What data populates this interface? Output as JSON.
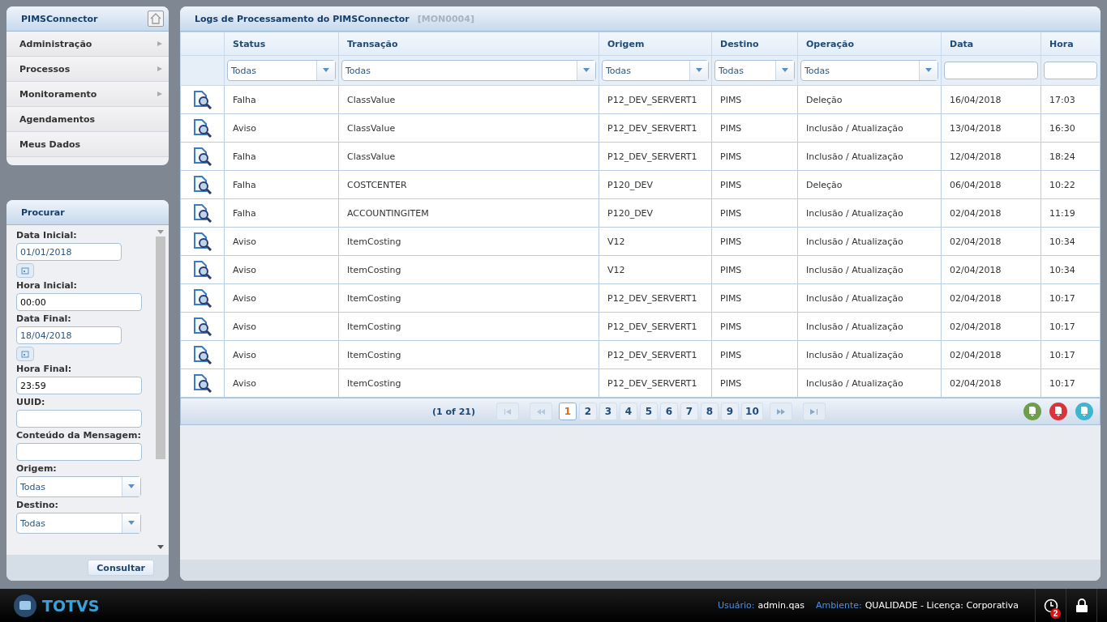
{
  "menu": {
    "title": "PIMSConnector",
    "items": [
      {
        "label": "Administração",
        "has_submenu": true
      },
      {
        "label": "Processos",
        "has_submenu": true
      },
      {
        "label": "Monitoramento",
        "has_submenu": true
      },
      {
        "label": "Agendamentos",
        "has_submenu": false
      },
      {
        "label": "Meus Dados",
        "has_submenu": false
      }
    ]
  },
  "search": {
    "title": "Procurar",
    "fields": [
      {
        "kind": "date",
        "label": "Data Inicial:",
        "value": "01/01/2018"
      },
      {
        "kind": "text",
        "label": "Hora Inicial:",
        "value": "00:00"
      },
      {
        "kind": "date",
        "label": "Data Final:",
        "value": "18/04/2018"
      },
      {
        "kind": "text",
        "label": "Hora Final:",
        "value": "23:59"
      },
      {
        "kind": "text",
        "label": "UUID:"
      },
      {
        "kind": "text",
        "label": "Conteúdo da Mensagem:"
      },
      {
        "kind": "select",
        "label": "Origem:",
        "value": "Todas"
      },
      {
        "kind": "select",
        "label": "Destino:",
        "value": "Todas"
      }
    ],
    "button": "Consultar"
  },
  "panel": {
    "title": "Logs de Processamento do PIMSConnector",
    "code": "[MON0004]"
  },
  "table": {
    "columns": [
      {
        "label": "Status",
        "filter": {
          "kind": "select",
          "value": "Todas"
        }
      },
      {
        "label": "Transação",
        "filter": {
          "kind": "select",
          "value": "Todas"
        }
      },
      {
        "label": "Origem",
        "filter": {
          "kind": "select",
          "value": "Todas"
        }
      },
      {
        "label": "Destino",
        "filter": {
          "kind": "select",
          "value": "Todas"
        }
      },
      {
        "label": "Operação",
        "filter": {
          "kind": "select",
          "value": "Todas"
        }
      },
      {
        "label": "Data",
        "filter": {
          "kind": "text"
        }
      },
      {
        "label": "Hora",
        "filter": {
          "kind": "text"
        }
      }
    ],
    "rows": [
      [
        "Falha",
        "ClassValue",
        "P12_DEV_SERVERT1",
        "PIMS",
        "Deleção",
        "16/04/2018",
        "17:03"
      ],
      [
        "Aviso",
        "ClassValue",
        "P12_DEV_SERVERT1",
        "PIMS",
        "Inclusão / Atualização",
        "13/04/2018",
        "16:30"
      ],
      [
        "Falha",
        "ClassValue",
        "P12_DEV_SERVERT1",
        "PIMS",
        "Inclusão / Atualização",
        "12/04/2018",
        "18:24"
      ],
      [
        "Falha",
        "COSTCENTER",
        "P120_DEV",
        "PIMS",
        "Deleção",
        "06/04/2018",
        "10:22"
      ],
      [
        "Falha",
        "ACCOUNTINGITEM",
        "P120_DEV",
        "PIMS",
        "Inclusão / Atualização",
        "02/04/2018",
        "11:19"
      ],
      [
        "Aviso",
        "ItemCosting",
        "V12",
        "PIMS",
        "Inclusão / Atualização",
        "02/04/2018",
        "10:34"
      ],
      [
        "Aviso",
        "ItemCosting",
        "V12",
        "PIMS",
        "Inclusão / Atualização",
        "02/04/2018",
        "10:34"
      ],
      [
        "Aviso",
        "ItemCosting",
        "P12_DEV_SERVERT1",
        "PIMS",
        "Inclusão / Atualização",
        "02/04/2018",
        "10:17"
      ],
      [
        "Aviso",
        "ItemCosting",
        "P12_DEV_SERVERT1",
        "PIMS",
        "Inclusão / Atualização",
        "02/04/2018",
        "10:17"
      ],
      [
        "Aviso",
        "ItemCosting",
        "P12_DEV_SERVERT1",
        "PIMS",
        "Inclusão / Atualização",
        "02/04/2018",
        "10:17"
      ],
      [
        "Aviso",
        "ItemCosting",
        "P12_DEV_SERVERT1",
        "PIMS",
        "Inclusão / Atualização",
        "02/04/2018",
        "10:17"
      ]
    ]
  },
  "pager": {
    "summary": "(1 of 21)",
    "pages": [
      {
        "label": "1",
        "selected": true
      },
      {
        "label": "2",
        "selected": false
      },
      {
        "label": "3",
        "selected": false
      },
      {
        "label": "4",
        "selected": false
      },
      {
        "label": "5",
        "selected": false
      },
      {
        "label": "6",
        "selected": false
      },
      {
        "label": "7",
        "selected": false
      },
      {
        "label": "8",
        "selected": false
      },
      {
        "label": "9",
        "selected": false
      },
      {
        "label": "10",
        "selected": false
      }
    ],
    "exports": [
      {
        "color": "#6d9e4c"
      },
      {
        "color": "#d8353a"
      },
      {
        "color": "#3fb6cf"
      }
    ]
  },
  "footer": {
    "brand": "TOTVS",
    "user_label": "Usuário:",
    "user": "admin.qas",
    "env_label": "Ambiente:",
    "env": "QUALIDADE - Licença: Corporativa",
    "badge": "2"
  }
}
